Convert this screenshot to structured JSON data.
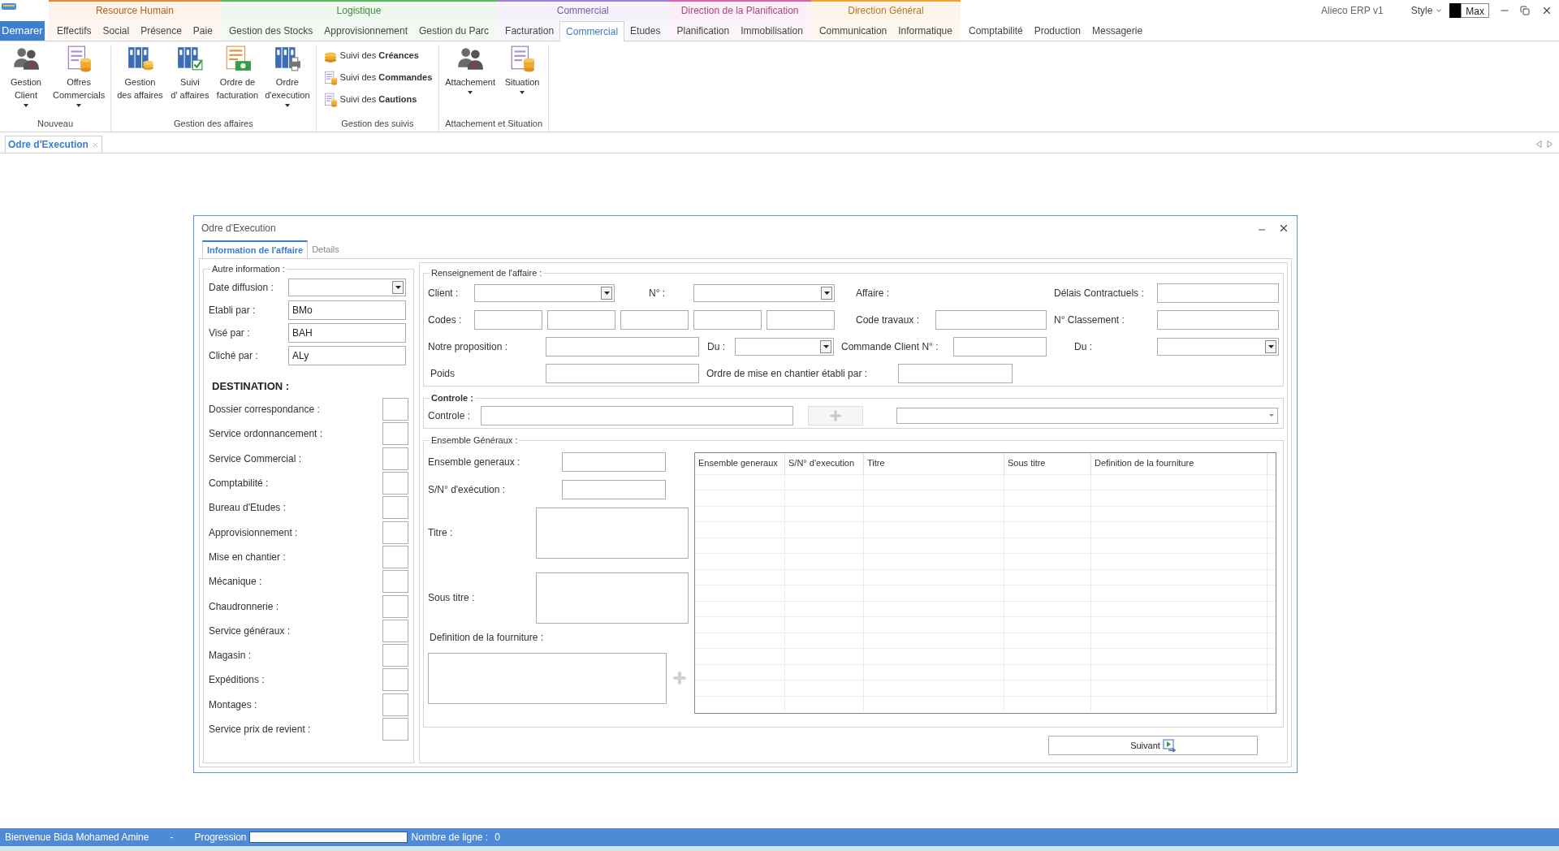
{
  "app": {
    "start_button": "Demarer",
    "title": "Alieco ERP v1",
    "style_menu": "Style",
    "theme_name": "Max"
  },
  "tab_groups": [
    {
      "label": "Resource Humain",
      "color": "#f0852d",
      "tabs": [
        {
          "label": "Effectifs",
          "selected": false
        },
        {
          "label": "Social",
          "selected": false
        },
        {
          "label": "Présence",
          "selected": false
        },
        {
          "label": "Paie",
          "selected": false
        }
      ]
    },
    {
      "label": "Logistique",
      "color": "#5cb85c",
      "tabs": [
        {
          "label": "Gestion des Stocks",
          "selected": false
        },
        {
          "label": "Approvisionnement",
          "selected": false
        },
        {
          "label": "Gestion du Parc",
          "selected": false
        }
      ]
    },
    {
      "label": "Commercial",
      "color": "#a07ee0",
      "tabs": [
        {
          "label": "Facturation",
          "selected": false
        },
        {
          "label": "Commercial",
          "selected": true
        },
        {
          "label": "Etudes",
          "selected": false
        }
      ]
    },
    {
      "label": "Direction de la Planification",
      "color": "#e060b0",
      "tabs": [
        {
          "label": "Planification",
          "selected": false
        },
        {
          "label": "Immobilisation",
          "selected": false
        }
      ]
    },
    {
      "label": "Direction Général",
      "color": "#f5a030",
      "tabs": [
        {
          "label": "Communication",
          "selected": false
        },
        {
          "label": "Informatique",
          "selected": false
        }
      ]
    },
    {
      "tabs": [
        {
          "label": "Comptabilité",
          "selected": false
        },
        {
          "label": "Production",
          "selected": false
        },
        {
          "label": "Messagerie",
          "selected": false
        }
      ]
    }
  ],
  "ribbon_groups": [
    {
      "label": "Nouveau",
      "items": [
        {
          "kind": "large",
          "lines": [
            "Gestion",
            "Client"
          ],
          "dropdown": true
        },
        {
          "kind": "large",
          "lines": [
            "Offres",
            "Commercials"
          ],
          "dropdown": true
        }
      ]
    },
    {
      "label": "Gestion des affaires",
      "items": [
        {
          "kind": "large",
          "lines": [
            "Gestion",
            "des affaires"
          ],
          "dropdown": false
        },
        {
          "kind": "large",
          "lines": [
            "Suivi",
            "d' affaires"
          ],
          "dropdown": false
        },
        {
          "kind": "large",
          "lines": [
            "Ordre de",
            "facturation"
          ],
          "dropdown": false
        },
        {
          "kind": "large",
          "lines": [
            "Ordre",
            "d'execution"
          ],
          "dropdown": true
        }
      ]
    },
    {
      "label": "Gestion des suivis",
      "items": [
        {
          "kind": "small",
          "label": "Suivi des **Créances**"
        },
        {
          "kind": "small",
          "label": "Suivi des **Commandes**"
        },
        {
          "kind": "small",
          "label": "Suivi des **Cautions**"
        }
      ]
    },
    {
      "label": "Attachement et Situation",
      "items": [
        {
          "kind": "large",
          "lines": [
            "Attachement"
          ],
          "dropdown": true
        },
        {
          "kind": "large",
          "lines": [
            "Situation"
          ],
          "dropdown": true
        }
      ]
    }
  ],
  "doc_tabs": [
    {
      "label": "Odre d'Execution",
      "selected": true
    }
  ],
  "dialog": {
    "title": "Odre d'Execution",
    "tabs": [
      {
        "label": "Information de l'affaire",
        "selected": true
      },
      {
        "label": "Details",
        "selected": false
      }
    ],
    "autre_information": {
      "legend": "Autre information :",
      "fields": [
        {
          "label": "Date diffusion :",
          "kind": "combo"
        },
        {
          "label": "Etabli par :",
          "kind": "text",
          "value": "BMo"
        },
        {
          "label": "Visé par :",
          "kind": "text",
          "value": "BAH"
        },
        {
          "label": "Cliché par :",
          "kind": "text",
          "value": "ALy"
        }
      ]
    },
    "destination": {
      "title": "DESTINATION :",
      "items": [
        {
          "label": "Dossier correspondance :",
          "checked": false
        },
        {
          "label": "Service ordonnancement :",
          "checked": false
        },
        {
          "label": "Service Commercial :",
          "checked": false
        },
        {
          "label": "Comptabilité :",
          "checked": false
        },
        {
          "label": "Bureau d'Etudes :",
          "checked": false
        },
        {
          "label": "Approvisionnement :",
          "checked": false
        },
        {
          "label": "Mise en chantier :",
          "checked": false
        },
        {
          "label": "Mécanique :",
          "checked": false
        },
        {
          "label": "Chaudronnerie :",
          "checked": false
        },
        {
          "label": "Service généraux :",
          "checked": false
        },
        {
          "label": "Magasin :",
          "checked": false
        },
        {
          "label": "Expéditions :",
          "checked": false
        },
        {
          "label": "Montages :",
          "checked": false
        },
        {
          "label": "Service prix de revient :",
          "checked": false
        }
      ]
    },
    "renseignement": {
      "legend": "Renseignement de l'affaire :",
      "fields": [
        {
          "label": "Client :",
          "kind": "combo"
        },
        {
          "label": "N° :",
          "kind": "combo"
        },
        {
          "label": "Affaire :",
          "kind": "none"
        },
        {
          "label": "Délais Contractuels :",
          "kind": "text"
        },
        {
          "label": "Codes :",
          "kind": "codes"
        },
        {
          "label": "Code travaux :",
          "kind": "text"
        },
        {
          "label": "N° Classement :",
          "kind": "text"
        },
        {
          "label": "Notre proposition :",
          "kind": "text"
        },
        {
          "label": "Du :",
          "kind": "combo"
        },
        {
          "label": "Commande Client N° :",
          "kind": "text"
        },
        {
          "label": "Du :",
          "kind": "combo"
        },
        {
          "label": "Poids",
          "kind": "text"
        },
        {
          "label": "Ordre de mise en chantier établi par :",
          "kind": "text"
        }
      ]
    },
    "controle": {
      "legend": "Controle :",
      "label": "Controle :",
      "add_disabled": true
    },
    "ensemble": {
      "legend": "Ensemble Généraux :",
      "ensemble_label": "Ensemble generaux :",
      "sn_label": "S/N° d'exécution :",
      "titre_label": "Titre :",
      "sous_titre_label": "Sous titre :",
      "definition_label": "Definition de la fourniture :",
      "add_disabled": true,
      "table": {
        "columns": [
          "Ensemble generaux",
          "S/N° d'execution",
          "Titre",
          "Sous titre",
          "Definition de la fourniture"
        ]
      }
    },
    "next_button": "Suivant"
  },
  "status_bar": {
    "welcome": "Bienvenue Bida Mohamed Amine",
    "separator": "-",
    "progress_label": "Progression",
    "progress": {
      "level": 0
    },
    "rows_label": "Nombre de ligne :",
    "rows_count": "0"
  }
}
